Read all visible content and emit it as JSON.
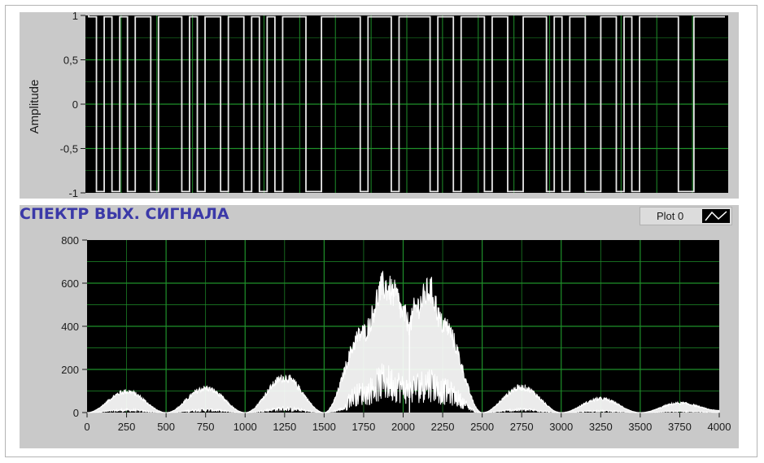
{
  "top_chart": {
    "ylabel": "Amplitude",
    "yticks": [
      "1",
      "0,5",
      "0",
      "-0,5",
      "-1"
    ],
    "ytick_values": [
      1,
      0.5,
      0,
      -0.5,
      -1
    ]
  },
  "spectrum": {
    "title": "СПЕКТР ВЫХ. СИГНАЛА",
    "legend_label": "Plot 0"
  },
  "colors": {
    "plot_bg": "#000000",
    "grid": "#1f8f2a",
    "trace": "#ffffff",
    "panel": "#c9c9c9",
    "title": "#3b39a8"
  },
  "chart_data": [
    {
      "type": "line",
      "ylabel": "Amplitude",
      "ylim": [
        -1,
        1
      ],
      "grid": true,
      "series": [
        {
          "values": [
            1,
            -1,
            1,
            -1,
            1,
            -1,
            1,
            1,
            -1,
            1,
            1,
            1,
            -1,
            1,
            -1,
            1,
            1,
            -1,
            1,
            1,
            -1,
            1,
            -1,
            1,
            -1,
            1,
            1,
            1,
            -1,
            -1,
            1,
            1,
            1,
            1,
            1,
            -1,
            1,
            1,
            1,
            -1,
            1,
            1,
            1,
            1,
            -1,
            1,
            1,
            -1,
            1,
            1,
            1,
            -1,
            1,
            1,
            -1,
            -1,
            1,
            1,
            1,
            -1,
            1,
            -1,
            1,
            1,
            -1,
            -1,
            1,
            1,
            -1,
            1,
            -1,
            1,
            1,
            1,
            1,
            1,
            -1,
            -1,
            1,
            1,
            1,
            1
          ]
        }
      ]
    },
    {
      "type": "line",
      "title": "СПЕКТР ВЫХ. СИГНАЛА",
      "xlim": [
        0,
        4000
      ],
      "ylim": [
        0,
        800
      ],
      "grid": true,
      "legend": "top-right",
      "xticks": [
        0,
        250,
        500,
        750,
        1000,
        1250,
        1500,
        1750,
        2000,
        2250,
        2500,
        2750,
        3000,
        3250,
        3500,
        3750,
        4000
      ],
      "yticks": [
        0,
        200,
        400,
        600,
        800
      ],
      "series": [
        {
          "name": "Plot 0",
          "envelope_x": [
            0,
            250,
            500,
            750,
            1000,
            1250,
            1500,
            1750,
            1880,
            1950,
            2000,
            2040,
            2080,
            2170,
            2250,
            2500,
            2750,
            3000,
            3250,
            3500,
            3750,
            4000
          ],
          "envelope_y": [
            0,
            100,
            0,
            115,
            0,
            165,
            0,
            380,
            600,
            560,
            470,
            420,
            500,
            580,
            420,
            0,
            120,
            0,
            65,
            0,
            45,
            10
          ]
        }
      ]
    }
  ]
}
